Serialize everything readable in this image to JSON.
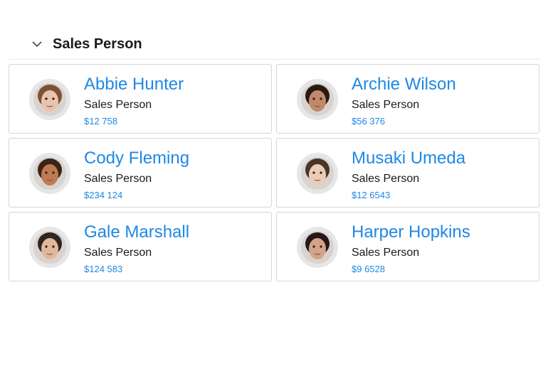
{
  "group": {
    "title": "Sales Person",
    "toggle_icon": "chevron-down-icon"
  },
  "people": [
    {
      "name": "Abbie Hunter",
      "role": "Sales Person",
      "amount": "$12 758",
      "avatar_icon": "avatar-photo-icon",
      "skin": "#e9c3ac",
      "hair": "#7a5236"
    },
    {
      "name": "Archie Wilson",
      "role": "Sales Person",
      "amount": "$56 376",
      "avatar_icon": "avatar-photo-icon",
      "skin": "#c08a6a",
      "hair": "#2a1a12"
    },
    {
      "name": "Cody Fleming",
      "role": "Sales Person",
      "amount": "$234 124",
      "avatar_icon": "avatar-photo-icon",
      "skin": "#c07a52",
      "hair": "#3a2418"
    },
    {
      "name": "Musaki Umeda",
      "role": "Sales Person",
      "amount": "$12 6543",
      "avatar_icon": "avatar-photo-icon",
      "skin": "#ecccb8",
      "hair": "#4a3428"
    },
    {
      "name": "Gale Marshall",
      "role": "Sales Person",
      "amount": "$124 583",
      "avatar_icon": "avatar-photo-icon",
      "skin": "#e2b89c",
      "hair": "#2e2620"
    },
    {
      "name": "Harper Hopkins",
      "role": "Sales Person",
      "amount": "$9 6528",
      "avatar_icon": "avatar-photo-icon",
      "skin": "#d4a48a",
      "hair": "#24181a"
    }
  ]
}
